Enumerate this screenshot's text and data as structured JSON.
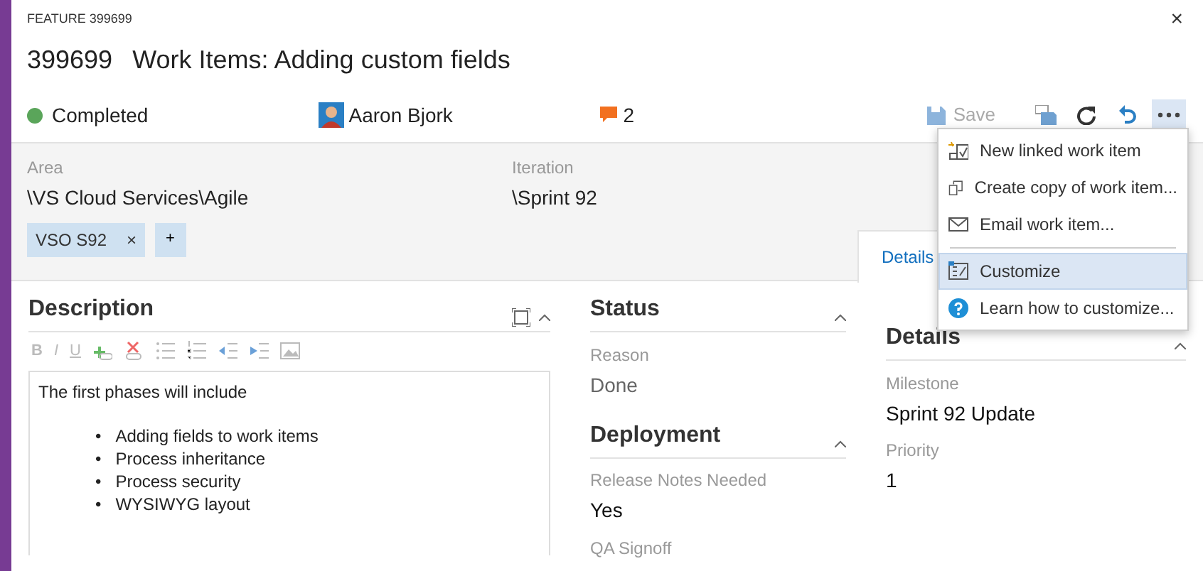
{
  "header": {
    "type_label": "FEATURE 399699",
    "close": "×",
    "id": "399699",
    "title": "Work Items: Adding custom fields"
  },
  "state": {
    "label": "Completed",
    "color": "#5aa55a"
  },
  "assigned_to": "Aaron Bjork",
  "comments": "2",
  "toolbar": {
    "save": {
      "label": "Save",
      "disabled": true
    }
  },
  "more_menu": {
    "expanded": true,
    "items": [
      {
        "kind": "item",
        "label": "New linked work item",
        "selected": false
      },
      {
        "kind": "item",
        "label": "Create copy of work item...",
        "selected": false
      },
      {
        "kind": "item",
        "label": "Email work item...",
        "selected": false
      },
      {
        "kind": "separator"
      },
      {
        "kind": "item",
        "label": "Customize",
        "selected": true
      },
      {
        "kind": "item",
        "label": "Learn how to customize...",
        "selected": false
      }
    ]
  },
  "area": {
    "label": "Area",
    "value": "\\VS Cloud Services\\Agile"
  },
  "iteration": {
    "label": "Iteration",
    "value": "\\Sprint 92"
  },
  "tags": [
    {
      "label": "VSO S92",
      "remove": "×"
    }
  ],
  "add_tag": "+",
  "tabs": [
    {
      "label": "Details",
      "selected": true
    }
  ],
  "description": {
    "title": "Description",
    "editor_toolbar": {
      "disabled": true,
      "format_buttons": [
        {
          "kind": "bold",
          "label": "B"
        },
        {
          "kind": "italic",
          "label": "I"
        },
        {
          "kind": "underline",
          "label": "U"
        }
      ]
    },
    "intro": "The first phases will include",
    "marker": "•",
    "bullets": [
      "Adding fields to work items",
      "Process inheritance",
      "Process security",
      "WYSIWYG layout"
    ]
  },
  "sections": [
    {
      "title": "Status",
      "fields": [
        {
          "label": "Reason",
          "value": "Done",
          "muted": true
        }
      ]
    },
    {
      "title": "Deployment",
      "fields": [
        {
          "label": "Release Notes Needed",
          "value": "Yes",
          "muted": false
        },
        {
          "label": "QA Signoff"
        }
      ]
    },
    {
      "title": "Details",
      "fields": [
        {
          "label": "Milestone",
          "value": "Sprint 92 Update",
          "muted": false
        },
        {
          "label": "Priority",
          "value": "1",
          "muted": false
        }
      ]
    }
  ]
}
